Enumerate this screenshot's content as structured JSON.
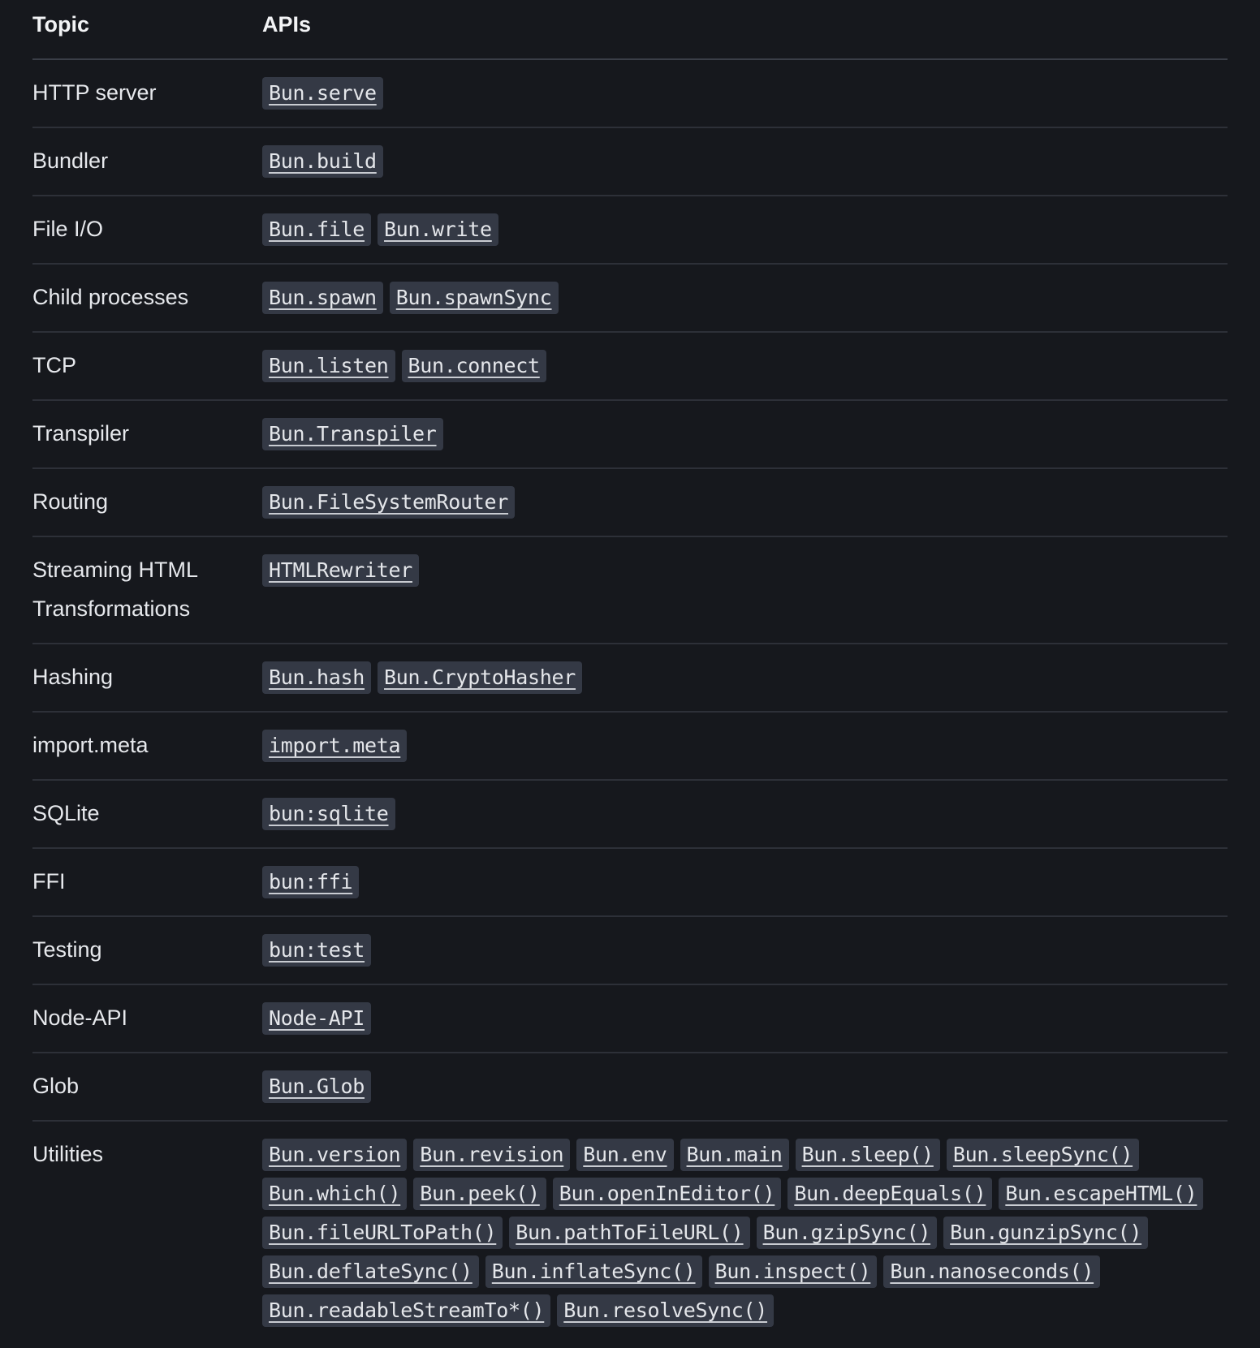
{
  "table": {
    "headers": {
      "topic": "Topic",
      "apis": "APIs"
    },
    "rows": [
      {
        "topic": "HTTP server",
        "apis": [
          "Bun.serve"
        ]
      },
      {
        "topic": "Bundler",
        "apis": [
          "Bun.build"
        ]
      },
      {
        "topic": "File I/O",
        "apis": [
          "Bun.file",
          "Bun.write"
        ]
      },
      {
        "topic": "Child processes",
        "apis": [
          "Bun.spawn",
          "Bun.spawnSync"
        ]
      },
      {
        "topic": "TCP",
        "apis": [
          "Bun.listen",
          "Bun.connect"
        ]
      },
      {
        "topic": "Transpiler",
        "apis": [
          "Bun.Transpiler"
        ]
      },
      {
        "topic": "Routing",
        "apis": [
          "Bun.FileSystemRouter"
        ]
      },
      {
        "topic": "Streaming HTML Transformations",
        "apis": [
          "HTMLRewriter"
        ]
      },
      {
        "topic": "Hashing",
        "apis": [
          "Bun.hash",
          "Bun.CryptoHasher"
        ]
      },
      {
        "topic": "import.meta",
        "apis": [
          "import.meta"
        ]
      },
      {
        "topic": "SQLite",
        "apis": [
          "bun:sqlite"
        ]
      },
      {
        "topic": "FFI",
        "apis": [
          "bun:ffi"
        ]
      },
      {
        "topic": "Testing",
        "apis": [
          "bun:test"
        ]
      },
      {
        "topic": "Node-API",
        "apis": [
          "Node-API"
        ]
      },
      {
        "topic": "Glob",
        "apis": [
          "Bun.Glob"
        ]
      },
      {
        "topic": "Utilities",
        "apis": [
          "Bun.version",
          "Bun.revision",
          "Bun.env",
          "Bun.main",
          "Bun.sleep()",
          "Bun.sleepSync()",
          "Bun.which()",
          "Bun.peek()",
          "Bun.openInEditor()",
          "Bun.deepEquals()",
          "Bun.escapeHTML()",
          "Bun.fileURLToPath()",
          "Bun.pathToFileURL()",
          "Bun.gzipSync()",
          "Bun.gunzipSync()",
          "Bun.deflateSync()",
          "Bun.inflateSync()",
          "Bun.inspect()",
          "Bun.nanoseconds()",
          "Bun.readableStreamTo*()",
          "Bun.resolveSync()"
        ]
      }
    ]
  }
}
